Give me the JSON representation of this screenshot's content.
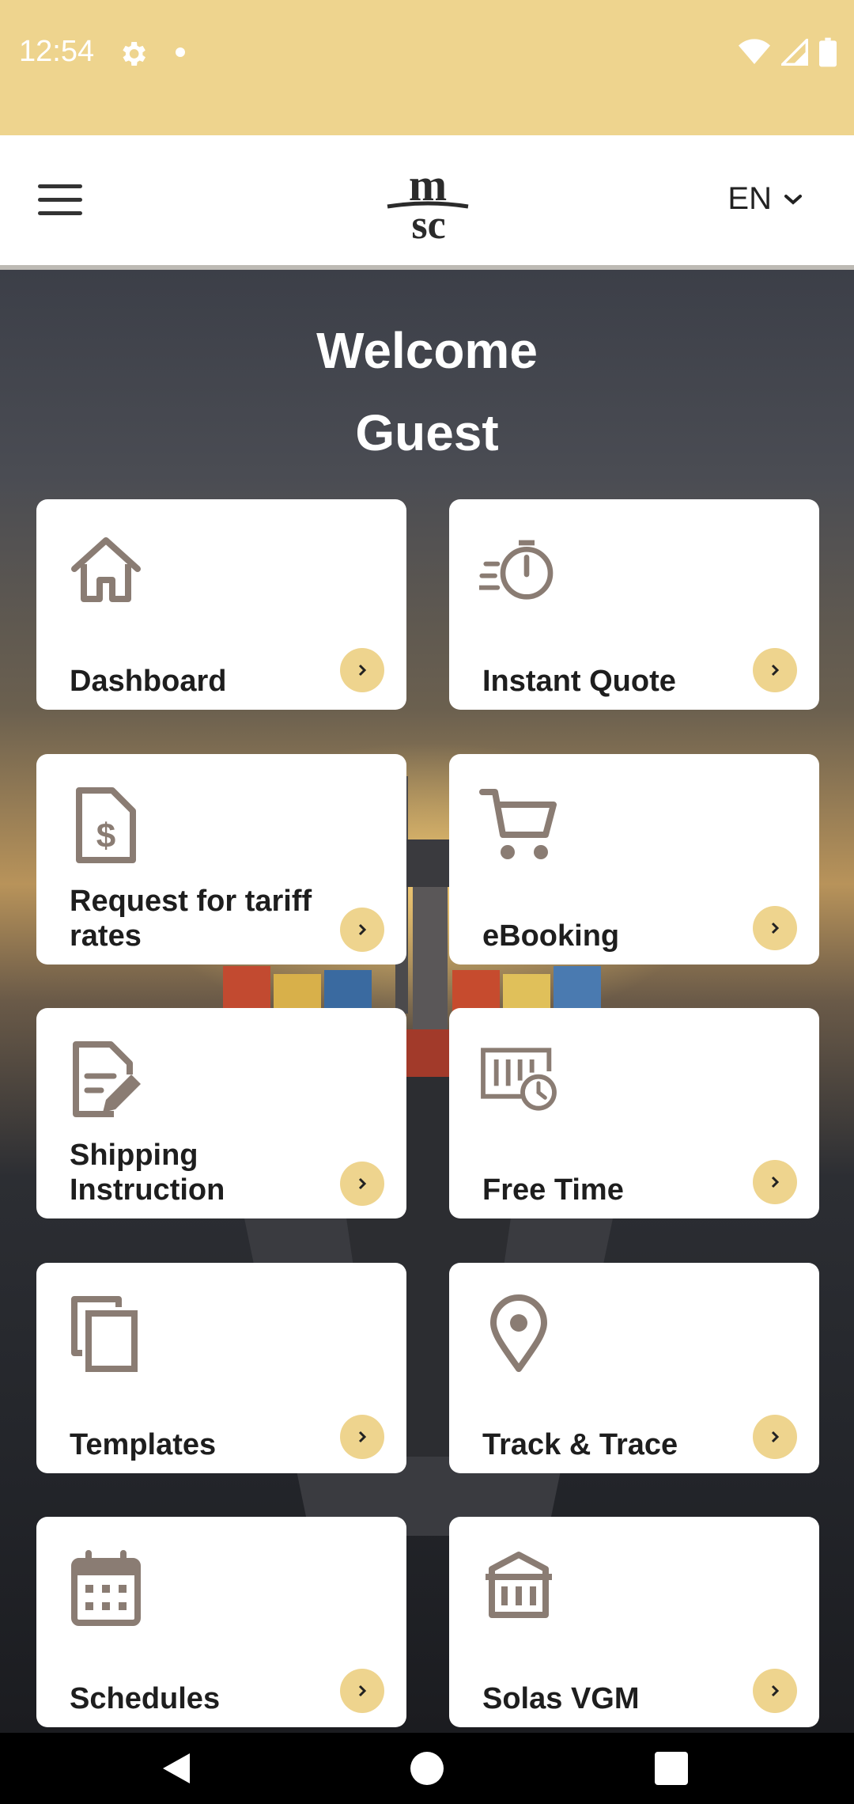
{
  "status_bar": {
    "time": "12:54"
  },
  "header": {
    "menu_icon": "hamburger-menu-icon",
    "logo_alt": "msc",
    "language": "EN"
  },
  "welcome": {
    "line1": "Welcome",
    "line2": "Guest"
  },
  "tiles": [
    {
      "label": "Dashboard",
      "icon": "home-icon"
    },
    {
      "label": "Instant Quote",
      "icon": "stopwatch-icon"
    },
    {
      "label": "Request for tariff rates",
      "icon": "dollar-document-icon"
    },
    {
      "label": "eBooking",
      "icon": "shopping-cart-icon"
    },
    {
      "label": "Shipping Instruction",
      "icon": "document-edit-icon"
    },
    {
      "label": "Free Time",
      "icon": "container-clock-icon"
    },
    {
      "label": "Templates",
      "icon": "copy-icon"
    },
    {
      "label": "Track & Trace",
      "icon": "location-pin-icon"
    },
    {
      "label": "Schedules",
      "icon": "calendar-icon"
    },
    {
      "label": "Solas VGM",
      "icon": "weighbridge-icon"
    }
  ],
  "colors": {
    "accent": "#eed48e",
    "icon": "#8a7c73",
    "text": "#1e1e1e"
  }
}
